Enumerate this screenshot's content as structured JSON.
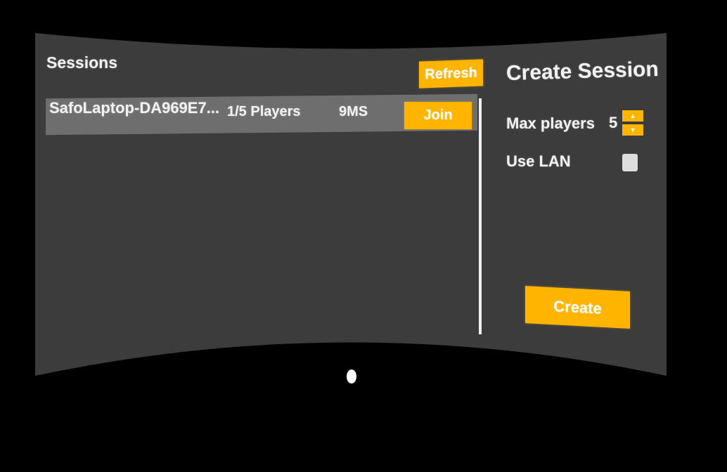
{
  "theme": {
    "background": "#000000",
    "panel": "#3c3c3c",
    "row_highlight": "#6e6e6e",
    "accent": "#ffb400",
    "text": "#f2f2f2"
  },
  "sessions_panel": {
    "title": "Sessions",
    "refresh_label": "Refresh",
    "rows": [
      {
        "name": "SafoLaptop-DA969E7...",
        "players": "1/5 Players",
        "ping": "9MS",
        "join_label": "Join"
      }
    ]
  },
  "create_panel": {
    "title": "Create Session",
    "max_players_label": "Max players",
    "max_players_value": "5",
    "stepper_up_icon": "▲",
    "stepper_down_icon": "▼",
    "use_lan_label": "Use LAN",
    "use_lan_checked": false,
    "create_label": "Create"
  }
}
